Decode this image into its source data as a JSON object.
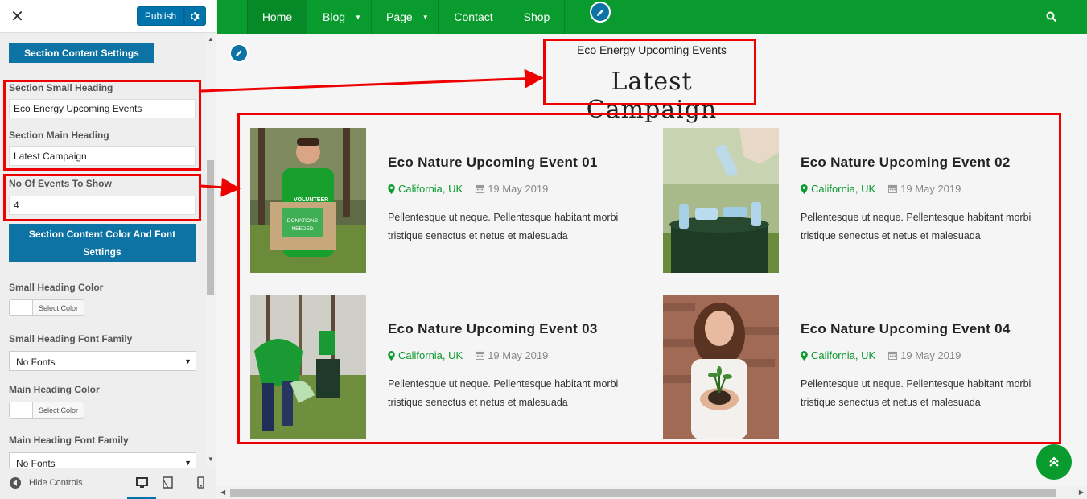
{
  "customizer": {
    "close_icon": "close-icon",
    "publish_label": "Publish",
    "section_content_settings": "Section Content Settings",
    "small_heading_label": "Section Small Heading",
    "small_heading_value": "Eco Energy Upcoming Events",
    "main_heading_label": "Section Main Heading",
    "main_heading_value": "Latest Campaign",
    "events_count_label": "No Of Events To Show",
    "events_count_value": "4",
    "color_font_settings": "Section Content Color And Font Settings",
    "small_heading_color_label": "Small Heading Color",
    "select_color": "Select Color",
    "small_heading_font_label": "Small Heading Font Family",
    "no_fonts": "No Fonts",
    "main_heading_color_label": "Main Heading Color",
    "main_heading_font_label": "Main Heading Font Family",
    "hide_controls": "Hide Controls"
  },
  "nav": {
    "items": [
      "Home",
      "Blog",
      "Page",
      "Contact",
      "Shop"
    ],
    "active": "Home",
    "color": "#0a9b2e"
  },
  "section": {
    "small_heading": "Eco Energy Upcoming Events",
    "main_heading": "Latest Campaign"
  },
  "events": [
    {
      "title": "Eco Nature Upcoming Event 01",
      "location": "California, UK",
      "date": "19 May 2019",
      "desc1": "Pellentesque ut neque. Pellentesque habitant morbi",
      "desc2": "tristique senectus et netus et malesuada"
    },
    {
      "title": "Eco Nature Upcoming Event 02",
      "location": "California, UK",
      "date": "19 May 2019",
      "desc1": "Pellentesque ut neque. Pellentesque habitant morbi",
      "desc2": "tristique senectus et netus et malesuada"
    },
    {
      "title": "Eco Nature Upcoming Event 03",
      "location": "California, UK",
      "date": "19 May 2019",
      "desc1": "Pellentesque ut neque. Pellentesque habitant morbi",
      "desc2": "tristique senectus et netus et malesuada"
    },
    {
      "title": "Eco Nature Upcoming Event 04",
      "location": "California, UK",
      "date": "19 May 2019",
      "desc1": "Pellentesque ut neque. Pellentesque habitant morbi",
      "desc2": "tristique senectus et netus et malesuada"
    }
  ],
  "image_texts": {
    "volunteer": "VOLUNTEER",
    "donations1": "DONATIONS",
    "donations2": "NEEDED"
  },
  "colors": {
    "accent": "#0a9b2e",
    "wp_blue": "#0d72a4",
    "annotation": "#e00000"
  }
}
